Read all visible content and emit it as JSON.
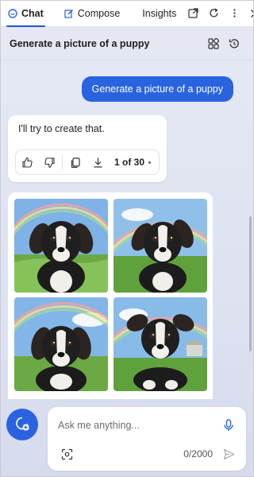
{
  "nav": {
    "tabs": [
      {
        "label": "Chat",
        "icon": "chat-bubble-icon",
        "active": true
      },
      {
        "label": "Compose",
        "icon": "pen-icon",
        "active": false
      },
      {
        "label": "Insights",
        "active": false
      }
    ],
    "actions": [
      "open-external-icon",
      "refresh-icon",
      "more-vertical-icon",
      "close-icon"
    ]
  },
  "header": {
    "title": "Generate a picture of a puppy",
    "actions": [
      "apps-grid-icon",
      "history-icon"
    ]
  },
  "conversation": {
    "user_message": "Generate a picture of a puppy",
    "bot_reply": "I'll try to create that.",
    "feedback": {
      "icons": [
        "thumbs-up-icon",
        "thumbs-down-icon",
        "copy-icon",
        "download-icon"
      ],
      "page": "1 of 30"
    },
    "images": [
      {
        "description": "puppy-rainbow-1"
      },
      {
        "description": "puppy-rainbow-2"
      },
      {
        "description": "puppy-rainbow-3"
      },
      {
        "description": "puppy-rainbow-4"
      }
    ]
  },
  "compose": {
    "placeholder": "Ask me anything...",
    "char_count": "0/2000",
    "icons": [
      "new-topic-icon",
      "mic-icon",
      "screenshot-icon",
      "send-icon"
    ]
  },
  "colors": {
    "accent": "#2a63e0",
    "background": "#e2e6f3"
  }
}
